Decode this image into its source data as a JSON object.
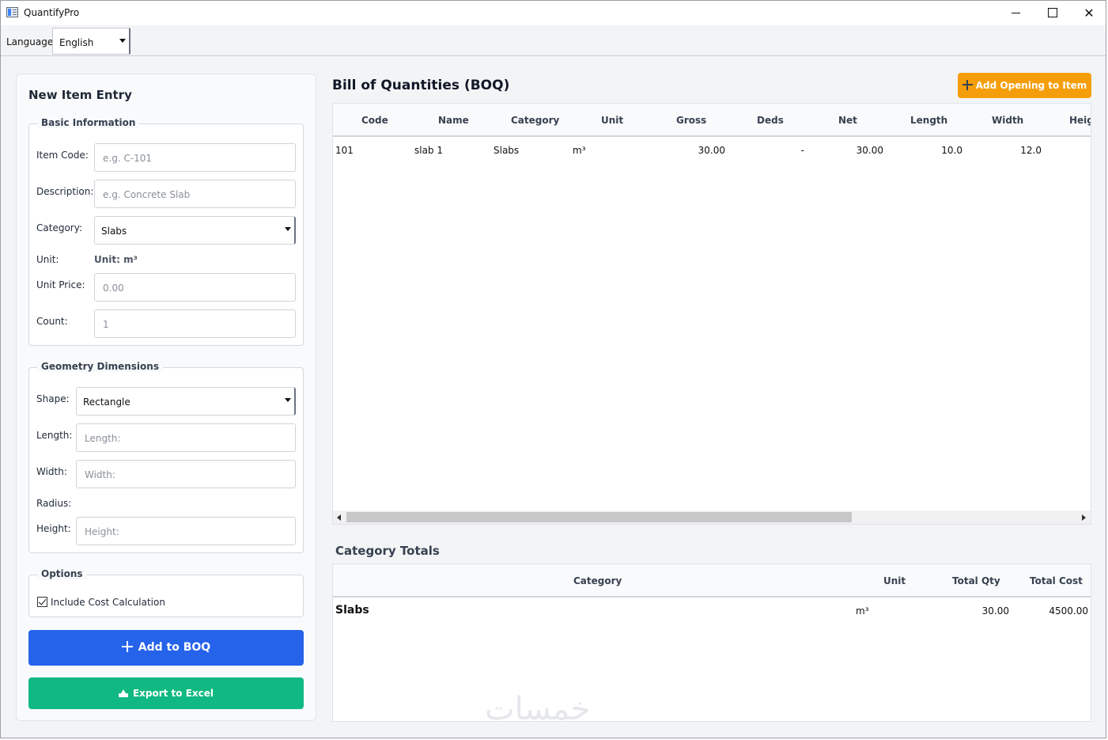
{
  "window": {
    "title": "QuantifyPro"
  },
  "language": {
    "label": "Language:",
    "value": "English"
  },
  "entry": {
    "title": "New Item Entry",
    "basic": {
      "title": "Basic Information",
      "item_code_label": "Item Code:",
      "item_code_placeholder": "e.g. C-101",
      "description_label": "Description:",
      "description_placeholder": "e.g. Concrete Slab",
      "category_label": "Category:",
      "category_value": "Slabs",
      "unit_label": "Unit:",
      "unit_value": "Unit: m³",
      "unit_price_label": "Unit Price:",
      "unit_price_placeholder": "0.00",
      "count_label": "Count:",
      "count_placeholder": "1"
    },
    "geometry": {
      "title": "Geometry Dimensions",
      "shape_label": "Shape:",
      "shape_value": "Rectangle",
      "length_label": "Length:",
      "length_placeholder": "Length:",
      "width_label": "Width:",
      "width_placeholder": "Width:",
      "radius_label": "Radius:",
      "height_label": "Height:",
      "height_placeholder": "Height:"
    },
    "options": {
      "title": "Options",
      "include_cost_label": "Include Cost Calculation",
      "include_cost_checked": true
    },
    "add_button": "Add to BOQ",
    "export_button": "Export to Excel"
  },
  "boq": {
    "title": "Bill of Quantities (BOQ)",
    "add_opening_button": "Add Opening to Item",
    "columns": [
      "Code",
      "Name",
      "Category",
      "Unit",
      "Gross",
      "Deds",
      "Net",
      "Length",
      "Width",
      "Heig"
    ],
    "rows": [
      [
        "101",
        "slab 1",
        "Slabs",
        "m³",
        "30.00",
        "-",
        "30.00",
        "10.0",
        "12.0",
        ""
      ]
    ]
  },
  "totals": {
    "title": "Category Totals",
    "columns": [
      "Category",
      "Unit",
      "Total Qty",
      "Total Cost"
    ],
    "rows": [
      [
        "Slabs",
        "m³",
        "30.00",
        "4500.00"
      ]
    ]
  },
  "watermark": "خمسات",
  "colors": {
    "add_button": "#2563eb",
    "export_button": "#10b981",
    "opening_button": "#f59e0b"
  }
}
